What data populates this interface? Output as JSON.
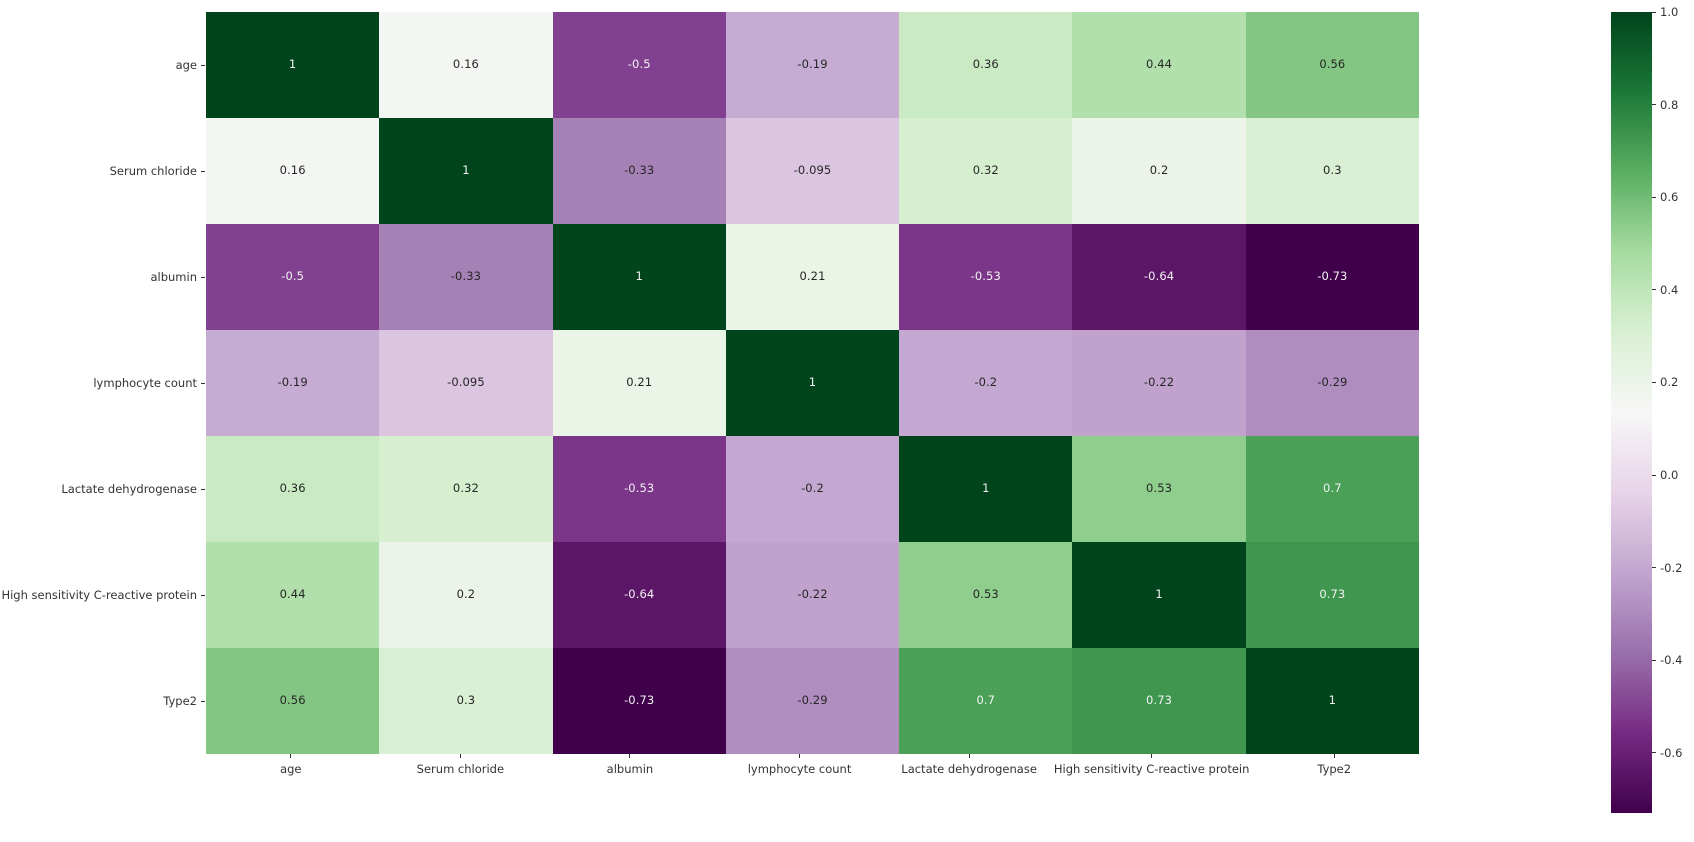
{
  "chart_data": {
    "type": "heatmap",
    "title": "",
    "xlabel": "",
    "ylabel": "",
    "colormap": "PRGn",
    "colorbar": {
      "position": "right",
      "vmin": -0.73,
      "vmax": 1.0,
      "ticks": [
        "1.0",
        "0.8",
        "0.6",
        "0.4",
        "0.2",
        "0.0",
        "-0.2",
        "-0.4",
        "-0.6"
      ],
      "tick_values": [
        1.0,
        0.8,
        0.6,
        0.4,
        0.2,
        0.0,
        -0.2,
        -0.4,
        -0.6
      ]
    },
    "x_categories": [
      "age",
      "Serum chloride",
      "albumin",
      "lymphocyte count",
      "Lactate dehydrogenase",
      "High sensitivity C-reactive protein",
      "Type2"
    ],
    "y_categories": [
      "age",
      "Serum chloride",
      "albumin",
      "lymphocyte count",
      "Lactate dehydrogenase",
      "High sensitivity C-reactive protein",
      "Type2"
    ],
    "values": [
      [
        1,
        0.16,
        -0.5,
        -0.19,
        0.36,
        0.44,
        0.56
      ],
      [
        0.16,
        1,
        -0.33,
        -0.095,
        0.32,
        0.2,
        0.3
      ],
      [
        -0.5,
        -0.33,
        1,
        0.21,
        -0.53,
        -0.64,
        -0.73
      ],
      [
        -0.19,
        -0.095,
        0.21,
        1,
        -0.2,
        -0.22,
        -0.29
      ],
      [
        0.36,
        0.32,
        -0.53,
        -0.2,
        1,
        0.53,
        0.7
      ],
      [
        0.44,
        0.2,
        -0.64,
        -0.22,
        0.53,
        1,
        0.73
      ],
      [
        0.56,
        0.3,
        -0.73,
        -0.29,
        0.7,
        0.73,
        1
      ]
    ],
    "annotations": [
      [
        "1",
        "0.16",
        "-0.5",
        "-0.19",
        "0.36",
        "0.44",
        "0.56"
      ],
      [
        "0.16",
        "1",
        "-0.33",
        "-0.095",
        "0.32",
        "0.2",
        "0.3"
      ],
      [
        "-0.5",
        "-0.33",
        "1",
        "0.21",
        "-0.53",
        "-0.64",
        "-0.73"
      ],
      [
        "-0.19",
        "-0.095",
        "0.21",
        "1",
        "-0.2",
        "-0.22",
        "-0.29"
      ],
      [
        "0.36",
        "0.32",
        "-0.53",
        "-0.2",
        "1",
        "0.53",
        "0.7"
      ],
      [
        "0.44",
        "0.2",
        "-0.64",
        "-0.22",
        "0.53",
        "1",
        "0.73"
      ],
      [
        "0.56",
        "0.3",
        "-0.73",
        "-0.29",
        "0.7",
        "0.73",
        "1"
      ]
    ]
  }
}
